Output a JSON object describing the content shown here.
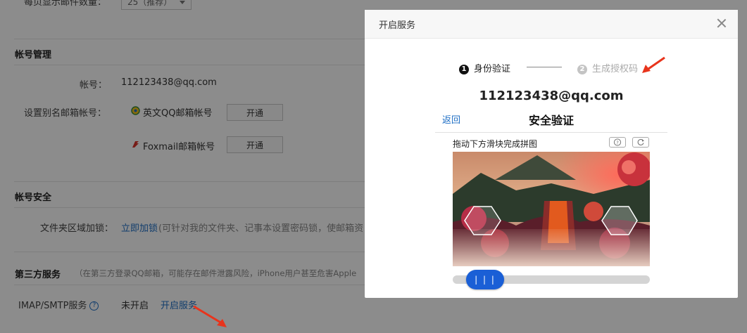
{
  "settings": {
    "per_page_label": "每页显示邮件数量：",
    "per_page_value": "25（推荐）",
    "account_mgmt_title": "帐号管理",
    "account_label": "帐号：",
    "account_value": "112123438@qq.com",
    "alias_label": "设置别名邮箱帐号：",
    "alias_en_label": "英文QQ邮箱帐号",
    "alias_foxmail_label": "Foxmail邮箱帐号",
    "open_button": "开通",
    "security_title": "帐号安全",
    "folder_lock_label": "文件夹区域加锁：",
    "folder_lock_link": "立即加锁",
    "folder_lock_desc": "(可针对我的文件夹、记事本设置密码锁，使邮箱资",
    "third_party_title": "第三方服务",
    "third_party_desc": "（在第三方登录QQ邮箱，可能存在邮件泄露风险，iPhone用户甚至危害Apple",
    "imap_label": "IMAP/SMTP服务",
    "imap_help": "?",
    "imap_status": "未开启",
    "imap_link": "开启服务"
  },
  "modal": {
    "title": "开启服务",
    "steps": [
      {
        "num": "1",
        "label": "身份验证"
      },
      {
        "num": "2",
        "label": "生成授权码"
      }
    ],
    "account": "112123438@qq.com",
    "captcha": {
      "back": "返回",
      "title": "安全验证",
      "hint": "拖动下方滑块完成拼图",
      "slider_label": "| | |",
      "slider_progress": 0.07
    }
  },
  "colors": {
    "link": "#1f6fc5",
    "slider": "#1a5fd6",
    "arrow": "#e8341c"
  },
  "icons": [
    "close-icon",
    "help-icon",
    "refresh-icon",
    "qq-icon",
    "foxmail-icon"
  ]
}
